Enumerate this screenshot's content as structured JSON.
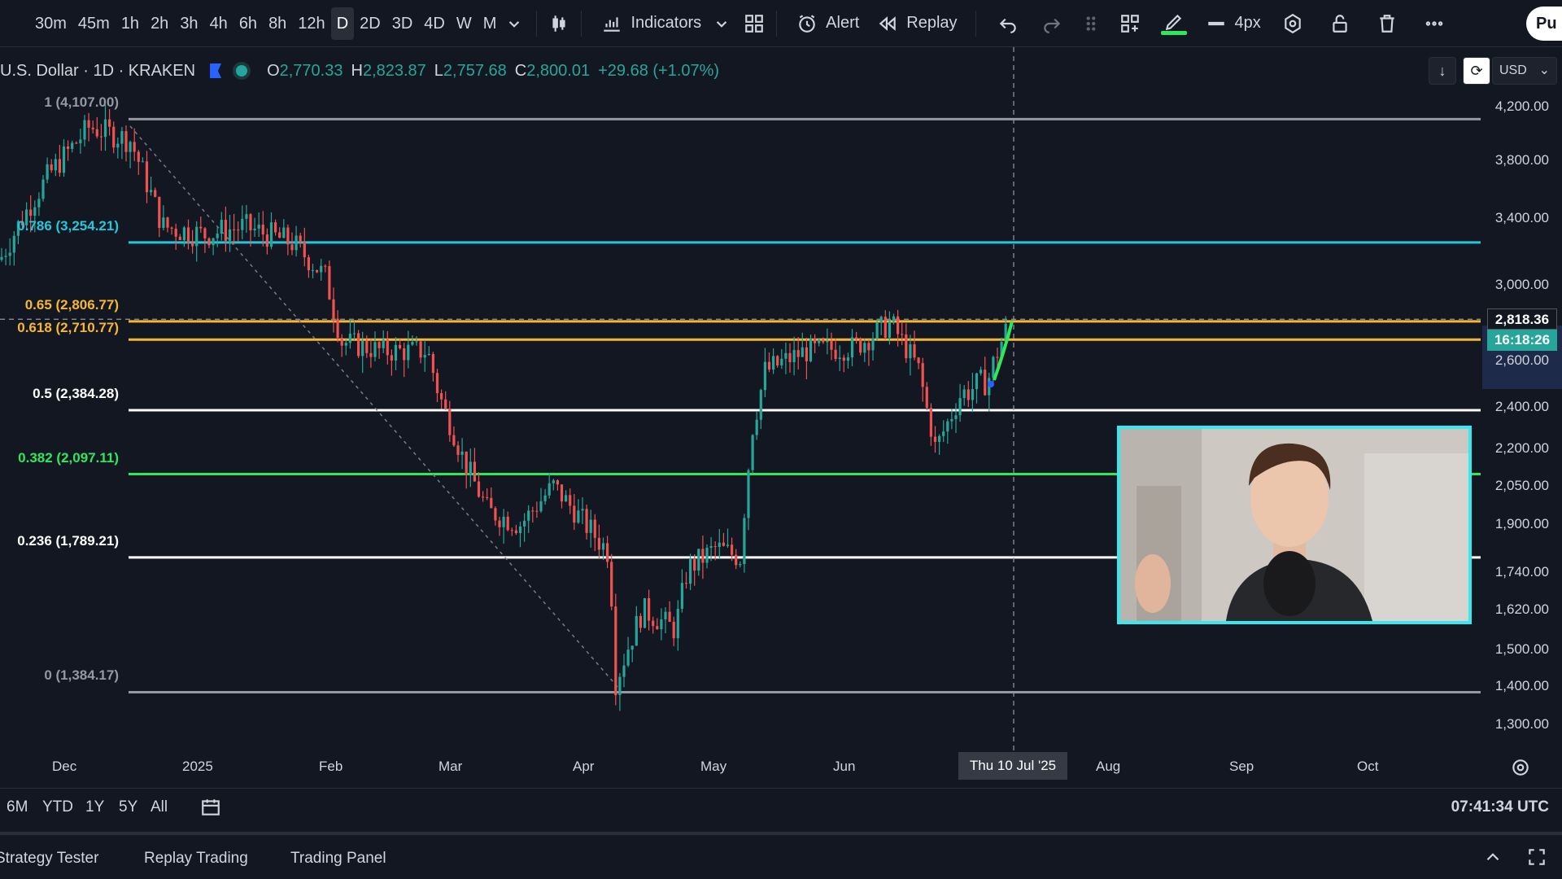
{
  "toolbar": {
    "timeframes": [
      "30m",
      "45m",
      "1h",
      "2h",
      "3h",
      "4h",
      "6h",
      "8h",
      "12h",
      "D",
      "2D",
      "3D",
      "4D",
      "W",
      "M"
    ],
    "active_timeframe": "D",
    "indicators_label": "Indicators",
    "alert_label": "Alert",
    "replay_label": "Replay",
    "line_width_label": "4px",
    "publish_label": "Pu",
    "icons": [
      "chevron-down-icon",
      "candles-icon",
      "indicators-icon",
      "layout-icon",
      "alert-clock-icon",
      "replay-icon",
      "undo-icon",
      "redo-icon",
      "drag-icon",
      "widgets-icon",
      "pencil-icon",
      "line-icon",
      "settings-icon",
      "lock-icon",
      "trash-icon",
      "more-icon"
    ]
  },
  "legend": {
    "symbol": "U.S. Dollar · 1D · KRAKEN",
    "open_k": "O",
    "open_v": "2,770.33",
    "high_k": "H",
    "high_v": "2,823.87",
    "low_k": "L",
    "low_v": "2,757.68",
    "close_k": "C",
    "close_v": "2,800.01",
    "change": "+29.68 (+1.07%)"
  },
  "currency": "USD",
  "fib_levels": [
    {
      "label": "1 (4,107.00)",
      "price": 4107,
      "color": "#9598a1"
    },
    {
      "label": "0.786 (3,254.21)",
      "price": 3254.21,
      "color": "#26c6da"
    },
    {
      "label": "0.65 (2,806.77)",
      "price": 2806.77,
      "color": "#f7b733"
    },
    {
      "label": "0.618 (2,710.77)",
      "price": 2710.77,
      "color": "#f7b733"
    },
    {
      "label": "0.5 (2,384.28)",
      "price": 2384.28,
      "color": "#ffffff"
    },
    {
      "label": "0.382 (2,097.11)",
      "price": 2097.11,
      "color": "#2ee85b"
    },
    {
      "label": "0.236 (1,789.21)",
      "price": 1789.21,
      "color": "#ffffff"
    },
    {
      "label": "0 (1,384.17)",
      "price": 1384.17,
      "color": "#9598a1"
    }
  ],
  "price_axis": [
    "4,200.00",
    "3,800.00",
    "3,400.00",
    "3,000.00",
    "2,600.00",
    "2,400.00",
    "2,200.00",
    "2,050.00",
    "1,900.00",
    "1,740.00",
    "1,620.00",
    "1,500.00",
    "1,400.00",
    "1,300.00"
  ],
  "crosshair_price": "2,818.36",
  "countdown": "16:18:26",
  "time_axis": [
    "Dec",
    "2025",
    "Feb",
    "Mar",
    "Apr",
    "May",
    "Jun",
    "Aug",
    "Sep",
    "Oct"
  ],
  "crosshair_date": "Thu 10 Jul '25",
  "ranges": [
    "6M",
    "YTD",
    "1Y",
    "5Y",
    "All"
  ],
  "clock": "07:41:34 UTC",
  "bottom_tabs": [
    "Strategy Tester",
    "Replay Trading",
    "Trading Panel"
  ]
}
